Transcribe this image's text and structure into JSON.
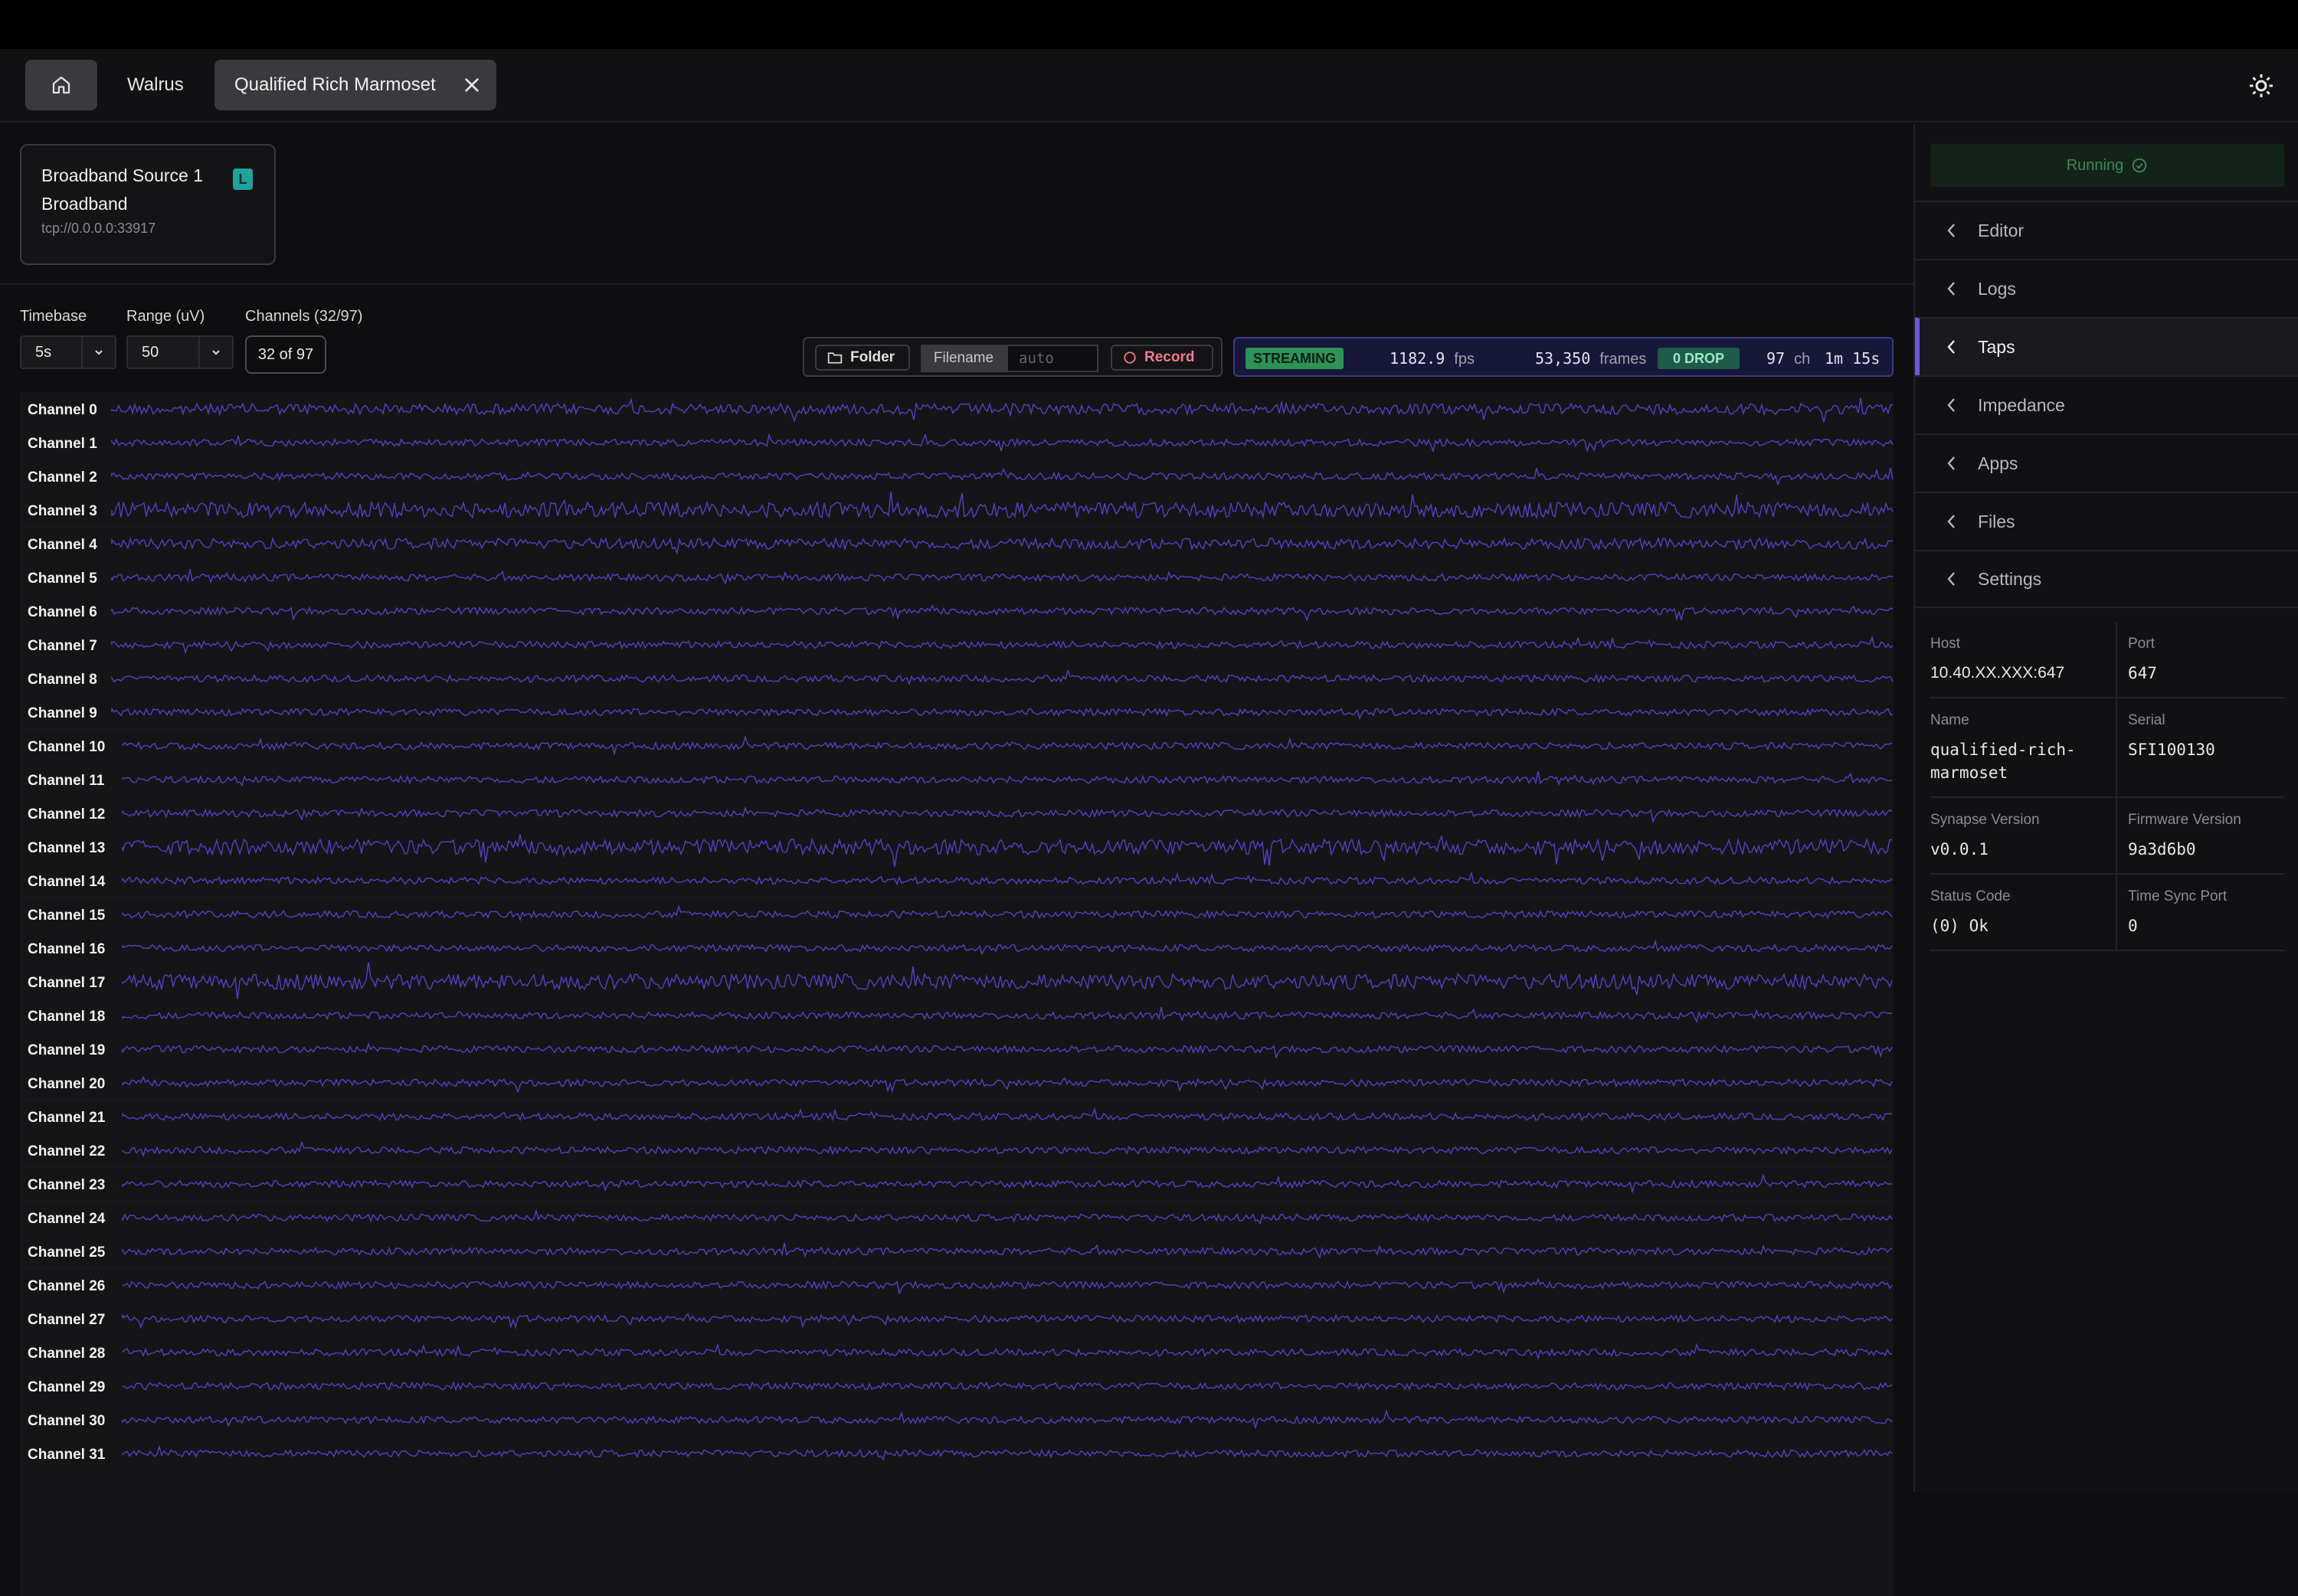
{
  "tabs": {
    "home_icon": "home-icon",
    "items": [
      {
        "label": "Walrus"
      },
      {
        "label": "Qualified Rich Marmoset"
      }
    ]
  },
  "source": {
    "title": "Broadband Source 1",
    "type": "Broadband",
    "address": "tcp://0.0.0.0:33917",
    "badge": "L"
  },
  "controls": {
    "timebase_label": "Timebase",
    "timebase_value": "5s",
    "range_label": "Range (uV)",
    "range_value": "50",
    "channels_label": "Channels (32/97)",
    "channels_value": "32 of 97"
  },
  "recorder": {
    "folder_label": "Folder",
    "filename_label": "Filename",
    "filename_placeholder": "auto",
    "record_label": "Record"
  },
  "stream": {
    "status": "STREAMING",
    "fps_value": "1182.9",
    "fps_unit": "fps",
    "frames_value": "53,350",
    "frames_unit": "frames",
    "drop": "0 DROP",
    "ch_value": "97",
    "ch_unit": "ch",
    "elapsed": "1m 15s"
  },
  "channels": [
    "Channel 0",
    "Channel 1",
    "Channel 2",
    "Channel 3",
    "Channel 4",
    "Channel 5",
    "Channel 6",
    "Channel 7",
    "Channel 8",
    "Channel 9",
    "Channel 10",
    "Channel 11",
    "Channel 12",
    "Channel 13",
    "Channel 14",
    "Channel 15",
    "Channel 16",
    "Channel 17",
    "Channel 18",
    "Channel 19",
    "Channel 20",
    "Channel 21",
    "Channel 22",
    "Channel 23",
    "Channel 24",
    "Channel 25",
    "Channel 26",
    "Channel 27",
    "Channel 28",
    "Channel 29",
    "Channel 30",
    "Channel 31"
  ],
  "colors": {
    "trace": "#5b45d6",
    "accent": "#6a58d8",
    "running": "#3c8a55"
  },
  "panel": {
    "status": "Running",
    "sections": [
      {
        "label": "Editor"
      },
      {
        "label": "Logs"
      },
      {
        "label": "Taps"
      },
      {
        "label": "Impedance"
      },
      {
        "label": "Apps"
      },
      {
        "label": "Files"
      },
      {
        "label": "Settings"
      }
    ],
    "active_section": "Taps",
    "info": {
      "host_label": "Host",
      "host": "10.40.XX.XXX:647",
      "port_label": "Port",
      "port": "647",
      "name_label": "Name",
      "name": "qualified-rich-marmoset",
      "serial_label": "Serial",
      "serial": "SFI100130",
      "synapse_label": "Synapse Version",
      "synapse": "v0.0.1",
      "firmware_label": "Firmware Version",
      "firmware": "9a3d6b0",
      "status_code_label": "Status Code",
      "status_code": "(0) Ok",
      "time_sync_label": "Time Sync Port",
      "time_sync": "0"
    }
  }
}
